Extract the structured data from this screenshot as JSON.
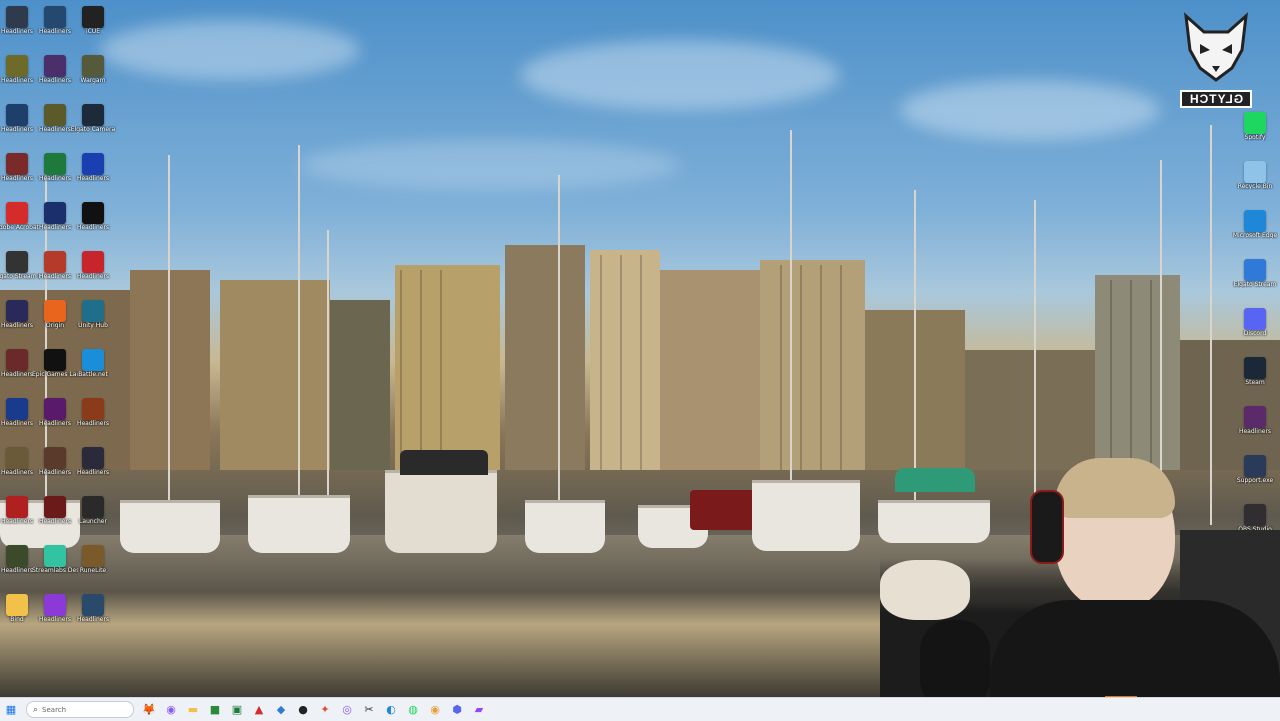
{
  "desktop": {
    "wallpaper": "vancouver-marina-skyline",
    "icons_left": [
      {
        "label": "Headliners",
        "icon": "game-icon",
        "color": "#2f3a4d"
      },
      {
        "label": "Headliners",
        "icon": "game-icon",
        "color": "#25496e"
      },
      {
        "label": "iCUE",
        "icon": "icue-icon",
        "color": "#222222"
      },
      {
        "label": "Headliners",
        "icon": "game-icon",
        "color": "#6e6b2a"
      },
      {
        "label": "Headliners",
        "icon": "game-icon",
        "color": "#4a2f6b"
      },
      {
        "label": "Wargam",
        "icon": "wargame-icon",
        "color": "#555a3a"
      },
      {
        "label": "Headliners",
        "icon": "game-icon",
        "color": "#1f3f6b"
      },
      {
        "label": "Headliners",
        "icon": "game-icon",
        "color": "#5a5a2a"
      },
      {
        "label": "Elgato Camera",
        "icon": "camera-icon",
        "color": "#1d2a3a"
      },
      {
        "label": "Headliners",
        "icon": "game-icon",
        "color": "#7b2a2a"
      },
      {
        "label": "Headliners",
        "icon": "game-icon",
        "color": "#1d7a3a"
      },
      {
        "label": "Headliners",
        "icon": "game-icon",
        "color": "#1a3fb0"
      },
      {
        "label": "Adobe Acrobat",
        "icon": "pdf-icon",
        "color": "#d42b2b"
      },
      {
        "label": "Headliners",
        "icon": "game-icon",
        "color": "#1a2f6b"
      },
      {
        "label": "Headliners",
        "icon": "game-icon",
        "color": "#111111"
      },
      {
        "label": "Elgato Stream Deck",
        "icon": "gear-icon",
        "color": "#333333"
      },
      {
        "label": "Headliners",
        "icon": "game-icon",
        "color": "#b53a2a"
      },
      {
        "label": "Headliners",
        "icon": "game-icon",
        "color": "#c8242b"
      },
      {
        "label": "Headliners",
        "icon": "game-icon",
        "color": "#2a2a5a"
      },
      {
        "label": "Origin",
        "icon": "origin-icon",
        "color": "#e9641d"
      },
      {
        "label": "Unity Hub",
        "icon": "unity-icon",
        "color": "#1f6f8b"
      },
      {
        "label": "Headliners",
        "icon": "game-icon",
        "color": "#6b2a2a"
      },
      {
        "label": "Epic Games Launcher",
        "icon": "epic-icon",
        "color": "#111111"
      },
      {
        "label": "Battle.net",
        "icon": "battlenet-icon",
        "color": "#1a8ed8"
      },
      {
        "label": "Headliners",
        "icon": "game-icon",
        "color": "#1a3a8b"
      },
      {
        "label": "Headliners",
        "icon": "game-icon",
        "color": "#5a1a6b"
      },
      {
        "label": "Headliners",
        "icon": "game-icon",
        "color": "#8b3a1a"
      },
      {
        "label": "Headliners",
        "icon": "game-icon",
        "color": "#6b5a3a"
      },
      {
        "label": "Headliners",
        "icon": "game-icon",
        "color": "#5a3a2a"
      },
      {
        "label": "Headliners",
        "icon": "game-icon",
        "color": "#2a2a3a"
      },
      {
        "label": "Headliners",
        "icon": "game-icon",
        "color": "#b02020"
      },
      {
        "label": "Headliners",
        "icon": "game-icon",
        "color": "#6b1a1a"
      },
      {
        "label": "Launcher",
        "icon": "xbox-app-icon",
        "color": "#2a2a2a"
      },
      {
        "label": "Headliners",
        "icon": "game-icon",
        "color": "#3a4a2a"
      },
      {
        "label": "Streamlabs Desktop",
        "icon": "streamlabs-icon",
        "color": "#31c3a2"
      },
      {
        "label": "RuneLite",
        "icon": "runelite-icon",
        "color": "#7a5a2a"
      },
      {
        "label": "Bind",
        "icon": "folder-icon",
        "color": "#f2c14a"
      },
      {
        "label": "Headliners",
        "icon": "game-icon",
        "color": "#8b3ad8"
      },
      {
        "label": "Headliners",
        "icon": "game-icon",
        "color": "#2a4a6b"
      }
    ],
    "icons_right": [
      {
        "label": "Spotify",
        "icon": "spotify-icon",
        "color": "#1ed760"
      },
      {
        "label": "Recycle Bin",
        "icon": "recycle-bin-icon",
        "color": "#8fc3e8"
      },
      {
        "label": "Microsoft Edge",
        "icon": "edge-icon",
        "color": "#1e87d8"
      },
      {
        "label": "Elgato Stream",
        "icon": "stream-icon",
        "color": "#2f7ad8"
      },
      {
        "label": "Discord",
        "icon": "discord-icon",
        "color": "#5865f2"
      },
      {
        "label": "Steam",
        "icon": "steam-icon",
        "color": "#1b2838"
      },
      {
        "label": "Headliners",
        "icon": "game-icon",
        "color": "#5a2a6b"
      },
      {
        "label": "Support.exe",
        "icon": "app-icon",
        "color": "#2a3a5a"
      },
      {
        "label": "OBS Studio",
        "icon": "obs-icon",
        "color": "#302e31"
      }
    ],
    "logo_text": "GLYTCH"
  },
  "taskbar": {
    "search_placeholder": "Search",
    "apps": [
      {
        "name": "start-button",
        "glyph": "▦",
        "color": "#1a73e8"
      },
      {
        "name": "fox-icon",
        "glyph": "🦊",
        "color": "#f28c28"
      },
      {
        "name": "copilot-icon",
        "glyph": "◉",
        "color": "#8a5cf6"
      },
      {
        "name": "file-explorer-icon",
        "glyph": "▬",
        "color": "#f2c14a"
      },
      {
        "name": "xbox-icon",
        "glyph": "■",
        "color": "#2a8a3a"
      },
      {
        "name": "excel-icon",
        "glyph": "▣",
        "color": "#1d7a3a"
      },
      {
        "name": "acrobat-icon",
        "glyph": "▲",
        "color": "#d42b2b"
      },
      {
        "name": "teams-icon",
        "glyph": "◆",
        "color": "#2f7ad8"
      },
      {
        "name": "camera-icon",
        "glyph": "●",
        "color": "#222222"
      },
      {
        "name": "figma-icon",
        "glyph": "✦",
        "color": "#e24a3a"
      },
      {
        "name": "chrome-icon",
        "glyph": "◎",
        "color": "#8a5cf6"
      },
      {
        "name": "capcut-icon",
        "glyph": "✂",
        "color": "#333333"
      },
      {
        "name": "edge-icon",
        "glyph": "◐",
        "color": "#1e87d8"
      },
      {
        "name": "spotify-icon",
        "glyph": "◍",
        "color": "#1ed760"
      },
      {
        "name": "chrome-icon",
        "glyph": "◉",
        "color": "#e8a13a"
      },
      {
        "name": "vpn-icon",
        "glyph": "⬢",
        "color": "#5865f2"
      },
      {
        "name": "twitch-icon",
        "glyph": "▰",
        "color": "#9146ff"
      }
    ]
  }
}
